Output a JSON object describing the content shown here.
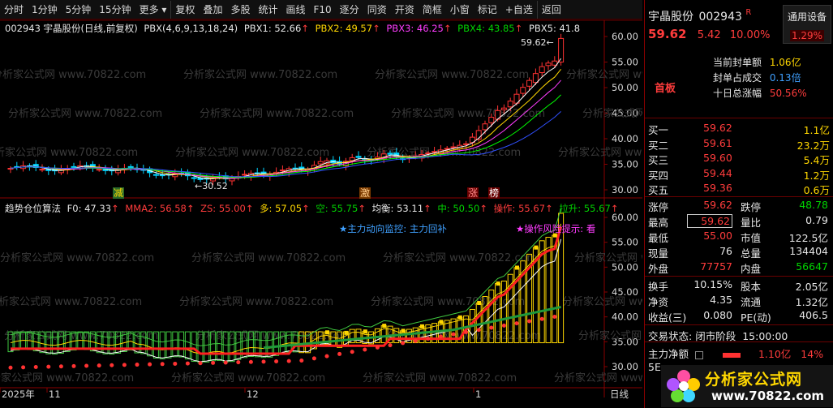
{
  "toolbar": {
    "items": [
      "分时",
      "1分钟",
      "5分钟",
      "15分钟",
      "更多",
      "复权",
      "叠加",
      "多股",
      "统计",
      "画线",
      "F10",
      "逐分",
      "同资",
      "开资",
      "简框",
      "小窗",
      "标记",
      "+自选",
      "返回"
    ]
  },
  "main_chart": {
    "header": "002943 宇晶股份(日线,前复权)",
    "pbx_params": "PBX(4,6,9,13,18,24)",
    "pbx1": "PBX1: 52.66",
    "pbx2": "PBX2: 49.57",
    "pbx3": "PBX3: 46.25",
    "pbx4": "PBX4: 43.85",
    "pbx5": "PBX5: 41.8",
    "high_marker": "59.62",
    "high_marker_arrow": "←",
    "low_marker": "←30.52",
    "y_ticks": [
      "60.00",
      "55.00",
      "50.00",
      "45.00",
      "40.00",
      "35.00",
      "30.00"
    ],
    "signals": [
      "减",
      "激",
      "涨",
      "榜"
    ],
    "colors": {
      "up": "#ff3232",
      "down": "#00d4ff",
      "pbx1": "#ffffff",
      "pbx2": "#ffd700",
      "pbx3": "#ff3cff",
      "pbx4": "#00ff00",
      "pbx5": "#3050ff"
    }
  },
  "sub_chart": {
    "name": "趋势仓位算法",
    "f0": "F0: 47.33",
    "mma2": "MMA2: 56.58",
    "zs": "ZS: 55.00",
    "duo": "多: 57.05",
    "kong": "空: 55.75",
    "junheng": "均衡: 53.11",
    "zhong": "中: 50.50",
    "caozuo": "操作: 55.67",
    "lasheng": "拉升: 55.67",
    "note1": "★主力动向监控: 主力回补",
    "note2": "★操作风险提示: 看",
    "y_ticks": [
      "60.00",
      "55.00",
      "50.00",
      "45.00",
      "40.00",
      "35.00",
      "30.00"
    ]
  },
  "x_axis": {
    "labels": [
      "2025年",
      "11",
      "12",
      "1"
    ],
    "period": "日线"
  },
  "quote": {
    "name": "宇晶股份",
    "code": "002943",
    "flag": "R",
    "category": "通用设备",
    "category_pct": "1.29%",
    "price": "59.62",
    "change": "5.42",
    "change_pct": "10.00%",
    "seal_label": "当前封单额",
    "seal_value": "1.06亿",
    "seal_ratio_label": "封单占成交",
    "seal_ratio_value": "0.13倍",
    "ten_day_label": "十日总涨幅",
    "ten_day_value": "50.56%",
    "board_tag": "首板"
  },
  "orders": [
    {
      "label": "买一",
      "price": "59.62",
      "vol": "1.1亿"
    },
    {
      "label": "买二",
      "price": "59.61",
      "vol": "23.2万"
    },
    {
      "label": "买三",
      "price": "59.60",
      "vol": "5.4万"
    },
    {
      "label": "买四",
      "price": "59.44",
      "vol": "1.2万"
    },
    {
      "label": "买五",
      "price": "59.36",
      "vol": "0.6万"
    }
  ],
  "stats": [
    {
      "l1": "涨停",
      "v1": "59.62",
      "l2": "跌停",
      "v2": "48.78"
    },
    {
      "l1": "最高",
      "v1": "59.62",
      "l2": "量比",
      "v2": "0.79"
    },
    {
      "l1": "最低",
      "v1": "55.00",
      "l2": "市值",
      "v2": "122.5亿"
    },
    {
      "l1": "现量",
      "v1": "76",
      "l2": "总量",
      "v2": "134404"
    },
    {
      "l1": "外盘",
      "v1": "77757",
      "l2": "内盘",
      "v2": "56647"
    }
  ],
  "stats2": [
    {
      "l1": "换手",
      "v1": "10.15%",
      "l2": "股本",
      "v2": "2.05亿"
    },
    {
      "l1": "净资",
      "v1": "4.35",
      "l2": "流通",
      "v2": "1.32亿"
    },
    {
      "l1": "收益(三)",
      "v1": "0.080",
      "l2": "PE(动)",
      "v2": "406.5"
    }
  ],
  "trade_state": {
    "label": "交易状态:",
    "state": "闭市阶段",
    "time": "15:00:00"
  },
  "net_flow": {
    "label": "主力净额",
    "value": "1.10亿",
    "pct": "14%"
  },
  "bottom_label": "5E",
  "watermark": "分析家公式网 www.70822.com",
  "logo": {
    "title": "分析家公式网",
    "url": "www.70822.com"
  }
}
